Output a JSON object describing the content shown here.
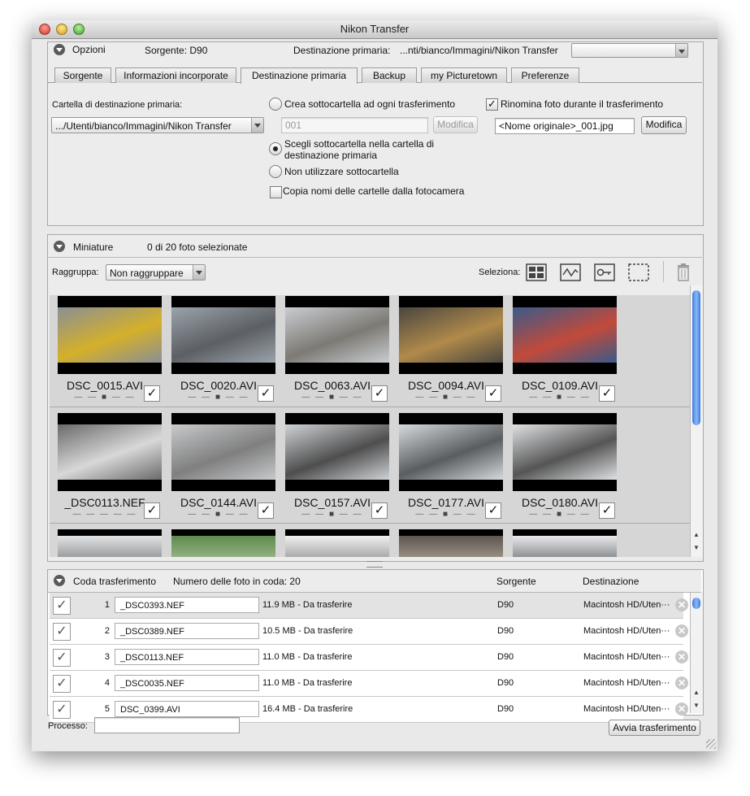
{
  "window": {
    "title": "Nikon Transfer"
  },
  "options": {
    "label": "Opzioni",
    "source_label": "Sorgente: D90",
    "dest_label": "Destinazione primaria:",
    "dest_path": "...nti/bianco/Immagini/Nikon Transfer"
  },
  "tabs": [
    "Sorgente",
    "Informazioni incorporate",
    "Destinazione primaria",
    "Backup",
    "my Picturetown",
    "Preferenze"
  ],
  "destination": {
    "folder_label": "Cartella di destinazione primaria:",
    "folder_value": ".../Utenti/bianco/Immagini/Nikon Transfer",
    "radio_create": "Crea sottocartella ad ogni trasferimento",
    "subfolder_value": "001",
    "modify_button": "Modifica",
    "radio_choose": "Scegli sottocartella nella cartella di",
    "radio_choose_line2": "destinazione primaria",
    "radio_none": "Non utilizzare sottocartella",
    "copy_names": "Copia nomi delle cartelle dalla fotocamera",
    "rename_label": "Rinomina foto durante il trasferimento",
    "rename_value": "<Nome originale>_001.jpg",
    "rename_button": "Modifica"
  },
  "thumbnails_panel": {
    "label": "Miniature",
    "count": "0 di 20 foto selezionate",
    "group_label": "Raggruppa:",
    "group_value": "Non raggruppare",
    "select_label": "Seleziona:"
  },
  "thumbs": [
    {
      "name": "DSC_0015.AVI",
      "video": true,
      "c1": "#8a8f95",
      "c2": "#d4b02a"
    },
    {
      "name": "DSC_0020.AVI",
      "video": true,
      "c1": "#9aa3ab",
      "c2": "#5c5f63"
    },
    {
      "name": "DSC_0063.AVI",
      "video": true,
      "c1": "#c9cdd1",
      "c2": "#7d7a74"
    },
    {
      "name": "DSC_0094.AVI",
      "video": true,
      "c1": "#4a4640",
      "c2": "#b08a4a"
    },
    {
      "name": "DSC_0109.AVI",
      "video": true,
      "c1": "#3a5a8a",
      "c2": "#c24a3a"
    },
    {
      "name": "_DSC0113.NEF",
      "video": false,
      "c1": "#6a6a6a",
      "c2": "#d8d8d8"
    },
    {
      "name": "DSC_0144.AVI",
      "video": true,
      "c1": "#c7c9cb",
      "c2": "#7f7f7f"
    },
    {
      "name": "DSC_0157.AVI",
      "video": true,
      "c1": "#d0d3d6",
      "c2": "#4e4e4e"
    },
    {
      "name": "DSC_0177.AVI",
      "video": true,
      "c1": "#d7dadd",
      "c2": "#5a5d60"
    },
    {
      "name": "DSC_0180.AVI",
      "video": true,
      "c1": "#dfe1e3",
      "c2": "#555"
    }
  ],
  "queue": {
    "label": "Coda trasferimento",
    "count": "Numero delle foto in coda: 20",
    "col_source": "Sorgente",
    "col_dest": "Destinazione",
    "rows": [
      {
        "n": "1",
        "name": "_DSC0393.NEF",
        "size": "11.9 MB - Da trasferire",
        "src": "D90",
        "dest": "Macintosh HD/Uten···"
      },
      {
        "n": "2",
        "name": "_DSC0389.NEF",
        "size": "10.5 MB - Da trasferire",
        "src": "D90",
        "dest": "Macintosh HD/Uten···"
      },
      {
        "n": "3",
        "name": "_DSC0113.NEF",
        "size": "11.0 MB - Da trasferire",
        "src": "D90",
        "dest": "Macintosh HD/Uten···"
      },
      {
        "n": "4",
        "name": "_DSC0035.NEF",
        "size": "11.0 MB - Da trasferire",
        "src": "D90",
        "dest": "Macintosh HD/Uten···"
      },
      {
        "n": "5",
        "name": "DSC_0399.AVI",
        "size": "16.4 MB - Da trasferire",
        "src": "D90",
        "dest": "Macintosh HD/Uten···"
      }
    ]
  },
  "footer": {
    "process_label": "Processo:",
    "start_button": "Avvia trasferimento"
  },
  "icons": {
    "video": "video-camera-icon",
    "check": "✓",
    "delete": "✕"
  },
  "colors": {
    "scroll_accent": "#3d7be0",
    "window_bg": "#e9e9e9"
  }
}
